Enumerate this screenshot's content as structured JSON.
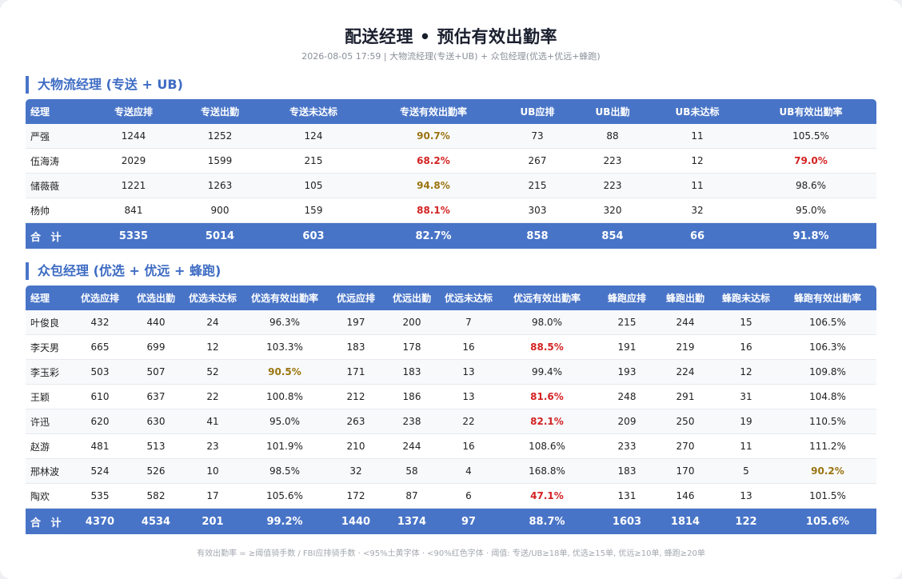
{
  "header": {
    "title": "配送经理 • 预估有效出勤率",
    "subtitle": "2026-08-05 17:59 | 大物流经理(专送+UB) + 众包经理(优选+优远+蜂跑)"
  },
  "colors": {
    "header_blue": "#4874c7",
    "section_blue": "#3e6cc3",
    "warn_yellow": "#9a7410",
    "alert_red": "#d32222"
  },
  "section1": {
    "title": "大物流经理 (专送 + UB)",
    "columns": [
      "经理",
      "专送应排",
      "专送出勤",
      "专送未达标",
      "专送有效出勤率",
      "UB应排",
      "UB出勤",
      "UB未达标",
      "UB有效出勤率"
    ],
    "rows": [
      {
        "cells": [
          "严强",
          "1244",
          "1252",
          "124",
          "90.7%",
          "73",
          "88",
          "11",
          "105.5%"
        ],
        "status": [
          "",
          "",
          "",
          "",
          "yellow",
          "",
          "",
          "",
          ""
        ]
      },
      {
        "cells": [
          "伍海涛",
          "2029",
          "1599",
          "215",
          "68.2%",
          "267",
          "223",
          "12",
          "79.0%"
        ],
        "status": [
          "",
          "",
          "",
          "",
          "red",
          "",
          "",
          "",
          "red"
        ]
      },
      {
        "cells": [
          "储薇薇",
          "1221",
          "1263",
          "105",
          "94.8%",
          "215",
          "223",
          "11",
          "98.6%"
        ],
        "status": [
          "",
          "",
          "",
          "",
          "yellow",
          "",
          "",
          "",
          ""
        ]
      },
      {
        "cells": [
          "杨帅",
          "841",
          "900",
          "159",
          "88.1%",
          "303",
          "320",
          "32",
          "95.0%"
        ],
        "status": [
          "",
          "",
          "",
          "",
          "red",
          "",
          "",
          "",
          ""
        ]
      }
    ],
    "total": [
      "合 计",
      "5335",
      "5014",
      "603",
      "82.7%",
      "858",
      "854",
      "66",
      "91.8%"
    ]
  },
  "section2": {
    "title": "众包经理 (优选 + 优远 + 蜂跑)",
    "columns": [
      "经理",
      "优选应排",
      "优选出勤",
      "优选未达标",
      "优选有效出勤率",
      "优远应排",
      "优远出勤",
      "优远未达标",
      "优远有效出勤率",
      "蜂跑应排",
      "蜂跑出勤",
      "蜂跑未达标",
      "蜂跑有效出勤率"
    ],
    "rows": [
      {
        "cells": [
          "叶俊良",
          "432",
          "440",
          "24",
          "96.3%",
          "197",
          "200",
          "7",
          "98.0%",
          "215",
          "244",
          "15",
          "106.5%"
        ],
        "status": [
          "",
          "",
          "",
          "",
          "",
          "",
          "",
          "",
          "",
          "",
          "",
          "",
          ""
        ]
      },
      {
        "cells": [
          "李天男",
          "665",
          "699",
          "12",
          "103.3%",
          "183",
          "178",
          "16",
          "88.5%",
          "191",
          "219",
          "16",
          "106.3%"
        ],
        "status": [
          "",
          "",
          "",
          "",
          "",
          "",
          "",
          "",
          "red",
          "",
          "",
          "",
          ""
        ]
      },
      {
        "cells": [
          "李玉彩",
          "503",
          "507",
          "52",
          "90.5%",
          "171",
          "183",
          "13",
          "99.4%",
          "193",
          "224",
          "12",
          "109.8%"
        ],
        "status": [
          "",
          "",
          "",
          "",
          "yellow",
          "",
          "",
          "",
          "",
          "",
          "",
          "",
          ""
        ]
      },
      {
        "cells": [
          "王颖",
          "610",
          "637",
          "22",
          "100.8%",
          "212",
          "186",
          "13",
          "81.6%",
          "248",
          "291",
          "31",
          "104.8%"
        ],
        "status": [
          "",
          "",
          "",
          "",
          "",
          "",
          "",
          "",
          "red",
          "",
          "",
          "",
          ""
        ]
      },
      {
        "cells": [
          "许迅",
          "620",
          "630",
          "41",
          "95.0%",
          "263",
          "238",
          "22",
          "82.1%",
          "209",
          "250",
          "19",
          "110.5%"
        ],
        "status": [
          "",
          "",
          "",
          "",
          "",
          "",
          "",
          "",
          "red",
          "",
          "",
          "",
          ""
        ]
      },
      {
        "cells": [
          "赵游",
          "481",
          "513",
          "23",
          "101.9%",
          "210",
          "244",
          "16",
          "108.6%",
          "233",
          "270",
          "11",
          "111.2%"
        ],
        "status": [
          "",
          "",
          "",
          "",
          "",
          "",
          "",
          "",
          "",
          "",
          "",
          "",
          ""
        ]
      },
      {
        "cells": [
          "邢林波",
          "524",
          "526",
          "10",
          "98.5%",
          "32",
          "58",
          "4",
          "168.8%",
          "183",
          "170",
          "5",
          "90.2%"
        ],
        "status": [
          "",
          "",
          "",
          "",
          "",
          "",
          "",
          "",
          "",
          "",
          "",
          "",
          "yellow"
        ]
      },
      {
        "cells": [
          "陶欢",
          "535",
          "582",
          "17",
          "105.6%",
          "172",
          "87",
          "6",
          "47.1%",
          "131",
          "146",
          "13",
          "101.5%"
        ],
        "status": [
          "",
          "",
          "",
          "",
          "",
          "",
          "",
          "",
          "red",
          "",
          "",
          "",
          ""
        ]
      }
    ],
    "total": [
      "合 计",
      "4370",
      "4534",
      "201",
      "99.2%",
      "1440",
      "1374",
      "97",
      "88.7%",
      "1603",
      "1814",
      "122",
      "105.6%"
    ]
  },
  "footer": {
    "note": "有效出勤率 = ≥阈值骑手数 / FBI应排骑手数 · <95%土黄字体 · <90%红色字体 · 阈值: 专送/UB≥18单, 优选≥15单, 优远≥10单, 蜂跑≥20单"
  }
}
